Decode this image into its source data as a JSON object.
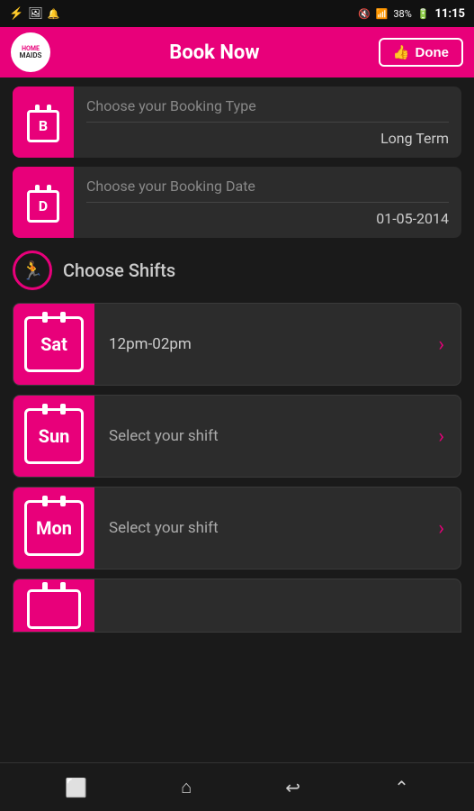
{
  "statusBar": {
    "battery": "38%",
    "time": "11:15",
    "icons": [
      "usb",
      "image",
      "notification-off",
      "wifi",
      "battery"
    ]
  },
  "header": {
    "logoTop": "HOME",
    "logoBottom": "MAIDS",
    "title": "Book Now",
    "doneLabel": "Done"
  },
  "bookingType": {
    "label": "Choose your Booking Type",
    "value": "Long Term",
    "iconLetter": "B"
  },
  "bookingDate": {
    "label": "Choose your Booking Date",
    "value": "01-05-2014",
    "iconLetter": "D"
  },
  "shiftsSection": {
    "label": "Choose Shifts"
  },
  "shifts": [
    {
      "day": "Sat",
      "time": "12pm-02pm",
      "selected": true
    },
    {
      "day": "Sun",
      "time": "Select your shift",
      "selected": false
    },
    {
      "day": "Mon",
      "time": "Select your shift",
      "selected": false
    }
  ],
  "bottomNav": {
    "icons": [
      "square",
      "home",
      "back",
      "up"
    ]
  }
}
